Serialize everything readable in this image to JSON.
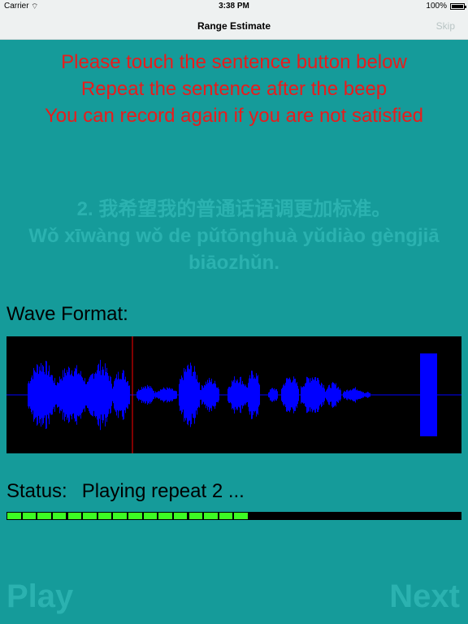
{
  "status_bar": {
    "carrier": "Carrier",
    "time": "3:38 PM",
    "battery": "100%"
  },
  "nav": {
    "title": "Range Estimate",
    "skip_label": "Skip"
  },
  "instructions": [
    "Please touch the sentence button below",
    "Repeat the sentence after the beep",
    "You can record again if you are not satisfied"
  ],
  "sentence": {
    "line1": "2. 我希望我的普通话语调更加标准。",
    "line2": "Wǒ xīwàng wǒ de pǔtōnghuà yǔdiào gèngjiā",
    "line3": "biāozhǔn."
  },
  "wave": {
    "label": "Wave Format:",
    "playhead_fraction": 0.276,
    "colors": {
      "waveform": "#0000ff",
      "playhead": "#ff0000",
      "background": "#000000"
    }
  },
  "status": {
    "label": "Status:",
    "value": "Playing repeat 2 ...",
    "progress_fraction": 0.533,
    "progress_segments": 16
  },
  "buttons": {
    "play_label": "Play",
    "next_label": "Next"
  },
  "colors": {
    "background": "#159b9a",
    "instruction_text": "#e81c1c",
    "progress": "#3dfb23"
  }
}
